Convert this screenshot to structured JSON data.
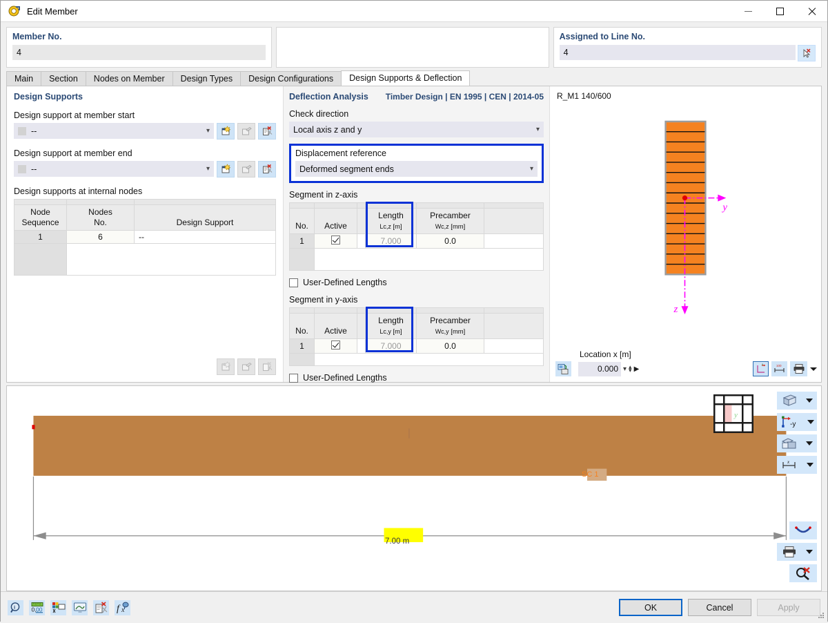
{
  "window": {
    "title": "Edit Member",
    "app_icon": "member-icon",
    "minimize": "minimize-icon",
    "maximize": "maximize-icon",
    "close": "close-icon"
  },
  "header": {
    "member_no_label": "Member No.",
    "member_no_value": "4",
    "assigned_line_label": "Assigned to Line No.",
    "assigned_line_value": "4",
    "pick_line_icon": "select-line-icon"
  },
  "tabs": [
    {
      "label": "Main",
      "active": false
    },
    {
      "label": "Section",
      "active": false
    },
    {
      "label": "Nodes on Member",
      "active": false
    },
    {
      "label": "Design Types",
      "active": false
    },
    {
      "label": "Design Configurations",
      "active": false
    },
    {
      "label": "Design Supports & Deflection",
      "active": true
    }
  ],
  "design_supports": {
    "title": "Design Supports",
    "start_label": "Design support at member start",
    "start_value": "--",
    "end_label": "Design support at member end",
    "end_value": "--",
    "internal_label": "Design supports at internal nodes",
    "table": {
      "headers": [
        "Node Sequence",
        "Nodes No.",
        "Design Support"
      ],
      "headers_line1": [
        "Node",
        "Nodes",
        ""
      ],
      "headers_line2": [
        "Sequence",
        "No.",
        "Design Support"
      ],
      "rows": [
        {
          "seq": "1",
          "node_no": "6",
          "support": "--"
        }
      ]
    },
    "row_buttons": [
      "new-icon",
      "edit-icon",
      "delete-icon"
    ]
  },
  "deflection": {
    "title": "Deflection Analysis",
    "standard": "Timber Design | EN 1995 | CEN | 2014-05",
    "check_direction_label": "Check direction",
    "check_direction_value": "Local axis z and y",
    "displacement_reference_label": "Displacement reference",
    "displacement_reference_value": "Deformed segment ends",
    "segment_z": {
      "title": "Segment in z-axis",
      "headers": {
        "no": "No.",
        "active": "Active",
        "length": "Length",
        "length_sym": "Lc,z",
        "length_unit": "[m]",
        "precamber": "Precamber",
        "precamber_sym": "Wc,z",
        "precamber_unit": "[mm]"
      },
      "rows": [
        {
          "no": "1",
          "active": true,
          "length": "7.000",
          "precamber": "0.0"
        }
      ],
      "user_defined_label": "User-Defined Lengths",
      "user_defined_checked": false
    },
    "segment_y": {
      "title": "Segment in y-axis",
      "headers": {
        "no": "No.",
        "active": "Active",
        "length": "Length",
        "length_sym": "Lc,y",
        "length_unit": "[m]",
        "precamber": "Precamber",
        "precamber_sym": "Wc,y",
        "precamber_unit": "[mm]"
      },
      "rows": [
        {
          "no": "1",
          "active": true,
          "length": "7.000",
          "precamber": "0.0"
        }
      ],
      "user_defined_label": "User-Defined Lengths",
      "user_defined_checked": false
    }
  },
  "cross_section": {
    "name": "R_M1 140/600",
    "axis_y_label": "y",
    "axis_z_label": "z",
    "laminations": 15,
    "fill_color": "#f58220",
    "location_label": "Location x [m]",
    "location_value": "0.000",
    "toolbar_left": [
      "render-mode-icon"
    ],
    "toolbar_right": [
      "axes-icon",
      "dimensions-icon",
      "print-icon"
    ]
  },
  "member_view": {
    "section_code_label": "SC 1",
    "dimension_label": "7.00 m",
    "beam_color": "#be8145",
    "nav_cube_icon": "view-cube-icon",
    "tools": [
      {
        "icon": "render-box-icon",
        "name": "render-mode"
      },
      {
        "icon": "axis-minus-y-icon",
        "name": "view-direction",
        "label": "-y"
      },
      {
        "icon": "layers-icon",
        "name": "display-mode"
      },
      {
        "icon": "dimension-x-icon",
        "name": "dimensions"
      }
    ],
    "tools_lower": [
      {
        "icon": "deformation-icon",
        "name": "deformation"
      },
      {
        "icon": "print-icon",
        "name": "print"
      },
      {
        "icon": "clear-selection-icon",
        "name": "clear-selection"
      }
    ]
  },
  "footer": {
    "tools": [
      "info-icon",
      "units-icon",
      "display-props-icon",
      "graphic-icon",
      "comment-icon",
      "formula-icon"
    ],
    "ok": "OK",
    "cancel": "Cancel",
    "apply": "Apply",
    "apply_disabled": true
  },
  "colors": {
    "accent_blue": "#0a32d6",
    "header_label": "#2b4a75",
    "section_orange": "#f58220",
    "beam_brown": "#be8145",
    "axis_magenta": "#ff00ff"
  }
}
